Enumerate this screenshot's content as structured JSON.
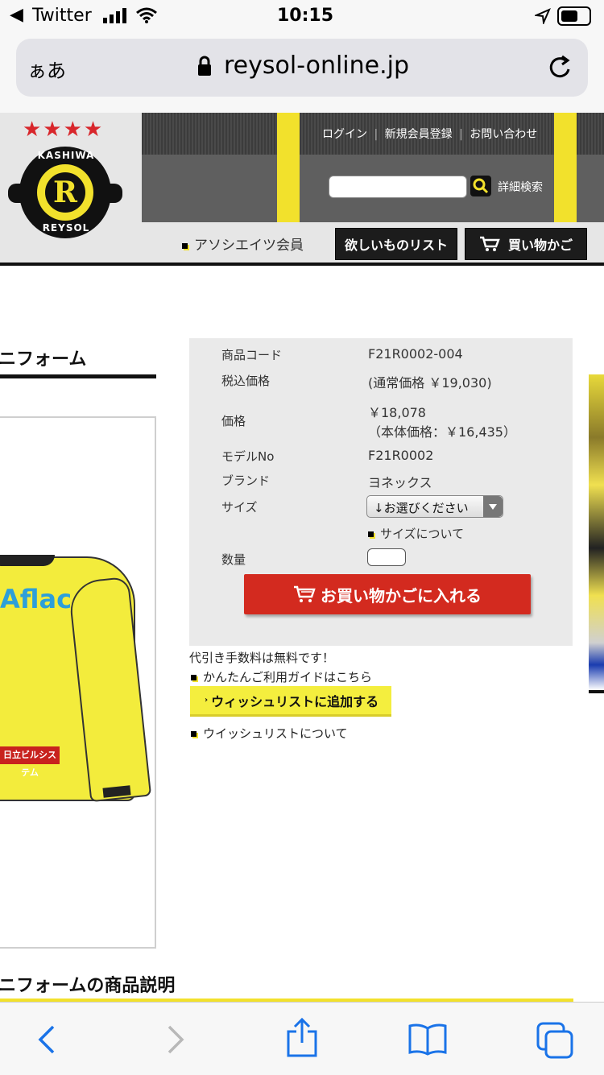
{
  "status": {
    "back_app": "Twitter",
    "time": "10:15"
  },
  "urlbar": {
    "aa": "ぁあ",
    "url": "reysol-online.jp"
  },
  "header": {
    "stars": "★★★★",
    "logo_top": "KASHIWA",
    "logo_bottom": "REYSOL",
    "logo_letter": "R",
    "links": [
      "ログイン",
      "新規会員登録",
      "お問い合わせ"
    ],
    "detail_search": "詳細検索",
    "associate": "アソシエイツ会員",
    "wishlist_btn": "欲しいものリスト",
    "cart_btn": "買い物かご"
  },
  "product": {
    "title_partial": "ニフォーム",
    "shirt_sponsor": "Aflac",
    "shirt_sleeve": "日立ビルシステム",
    "desc_title_partial": "ニフォームの商品説明"
  },
  "spec": {
    "rows": [
      {
        "label": "商品コード",
        "value": "F21R0002-004"
      },
      {
        "label": "税込価格",
        "value": "(通常価格 ￥19,030)"
      },
      {
        "label": "価格",
        "value": "￥18,078",
        "value2": "（本体価格：￥16,435）"
      },
      {
        "label": "モデルNo",
        "value": "F21R0002"
      },
      {
        "label": "ブランド",
        "value": "ヨネックス"
      },
      {
        "label": "サイズ",
        "value": "↓お選びください"
      },
      {
        "label": "数量",
        "value": ""
      }
    ],
    "size_link": "サイズについて",
    "add_to_cart": "お買い物かごに入れる"
  },
  "below": {
    "cod_note": "代引き手数料は無料です！",
    "guide_link": "かんたんご利用ガイドはこちら",
    "wishlist_add": "ウィッシュリストに追加する",
    "wishlist_about": "ウイッシュリストについて"
  },
  "colors": {
    "accent_yellow": "#f2e12c",
    "cart_red": "#d32a1f",
    "header_gray": "#5f5f5f"
  }
}
